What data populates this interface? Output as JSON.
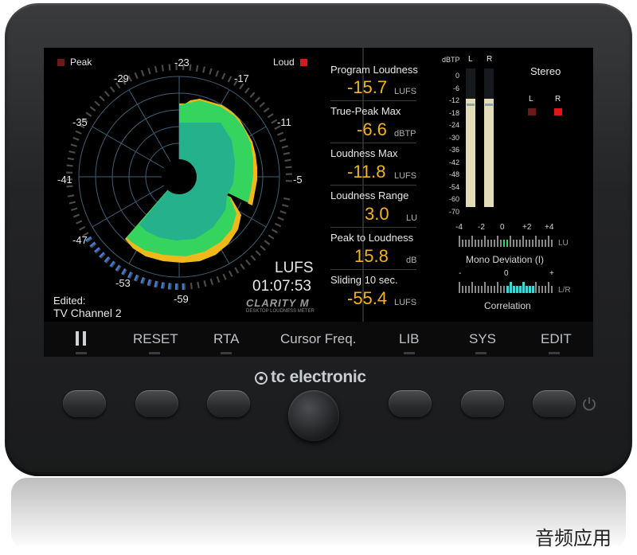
{
  "brand": {
    "name": "tc electronic",
    "icon": "tc-logo-icon"
  },
  "watermark": "音频应用",
  "radar": {
    "peak_label": "Peak",
    "loud_label": "Loud",
    "peak_color": "#6b1a1a",
    "loud_color": "#e0161a",
    "scale": [
      "-23",
      "-17",
      "-11",
      "-5",
      "-29",
      "-35",
      "-41",
      "-47",
      "-53",
      "-59"
    ],
    "unit": "LUFS",
    "time": "01:07:53",
    "edited_label": "Edited:",
    "edited_value": "TV Channel 2",
    "product_logo": "CLARITY M",
    "product_sub": "DESKTOP LOUDNESS METER"
  },
  "readings": [
    {
      "label": "Program Loudness",
      "value": "-15.7",
      "unit": "LUFS"
    },
    {
      "label": "True-Peak Max",
      "value": "-6.6",
      "unit": "dBTP"
    },
    {
      "label": "Loudness Max",
      "value": "-11.8",
      "unit": "LUFS"
    },
    {
      "label": "Loudness Range",
      "value": "3.0",
      "unit": "LU"
    },
    {
      "label": "Peak to Loudness",
      "value": "15.8",
      "unit": "dB"
    },
    {
      "label": "Sliding 10 sec.",
      "value": "-55.4",
      "unit": "LUFS"
    }
  ],
  "meter": {
    "unit": "dBTP",
    "channels": [
      "L",
      "R"
    ],
    "scale": [
      "0",
      "-6",
      "-12",
      "-18",
      "-24",
      "-30",
      "-36",
      "-42",
      "-48",
      "-54",
      "-60",
      "-70"
    ],
    "levels": {
      "L": 0.78,
      "R": 0.78
    },
    "mode": "Stereo",
    "indicators": [
      "L",
      "R"
    ]
  },
  "mono_deviation": {
    "scale": [
      "-4",
      "-2",
      "0",
      "+2",
      "+4"
    ],
    "unit": "LU",
    "label": "Mono Deviation (I)"
  },
  "correlation": {
    "scale": [
      "-",
      "0",
      "+"
    ],
    "unit": "L/R",
    "label": "Correlation"
  },
  "softkeys": [
    "RESET",
    "RTA",
    "Cursor Freq.",
    "LIB",
    "SYS",
    "EDIT"
  ],
  "colors": {
    "accent": "#f2b51a",
    "green": "#35d468",
    "teal": "#1fa69a",
    "scale_blue": "#3d7be0"
  }
}
